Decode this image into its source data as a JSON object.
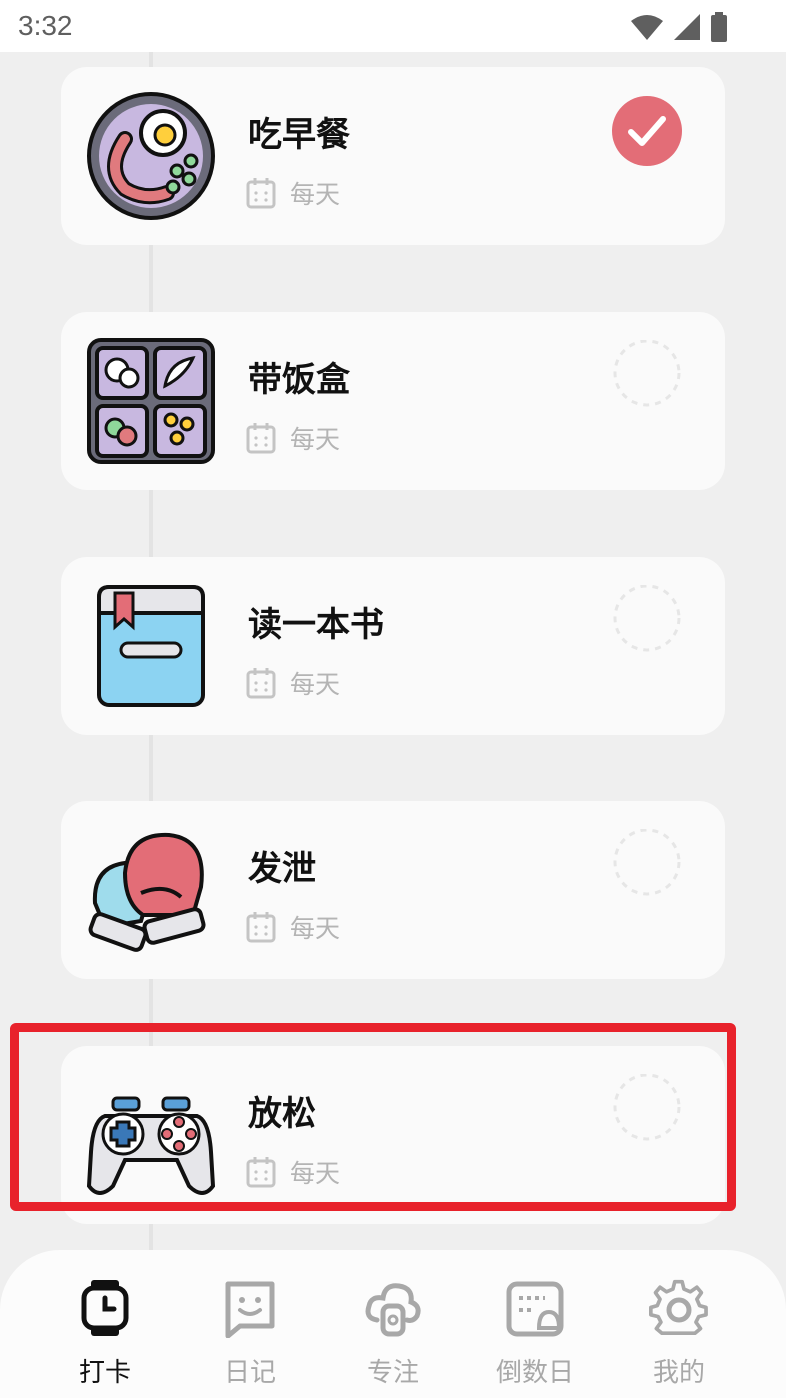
{
  "status_bar": {
    "time": "3:32"
  },
  "habits": [
    {
      "name": "吃早餐",
      "frequency": "每天",
      "done": true,
      "icon": "breakfast-plate-icon"
    },
    {
      "name": "带饭盒",
      "frequency": "每天",
      "done": false,
      "icon": "lunchbox-icon"
    },
    {
      "name": "读一本书",
      "frequency": "每天",
      "done": false,
      "icon": "book-icon"
    },
    {
      "name": "发泄",
      "frequency": "每天",
      "done": false,
      "icon": "boxing-gloves-icon"
    },
    {
      "name": "放松",
      "frequency": "每天",
      "done": false,
      "icon": "gamepad-icon"
    }
  ],
  "tabs": [
    {
      "label": "打卡",
      "icon": "watch-icon",
      "active": true
    },
    {
      "label": "日记",
      "icon": "diary-face-icon",
      "active": false
    },
    {
      "label": "专注",
      "icon": "focus-icon",
      "active": false
    },
    {
      "label": "倒数日",
      "icon": "countdown-calendar-icon",
      "active": false
    },
    {
      "label": "我的",
      "icon": "gear-icon",
      "active": false
    }
  ],
  "colors": {
    "done_check": "#e36d77",
    "highlight_box": "#e8222b",
    "active_tab": "#111111",
    "inactive_tab": "#a8a8a8"
  }
}
